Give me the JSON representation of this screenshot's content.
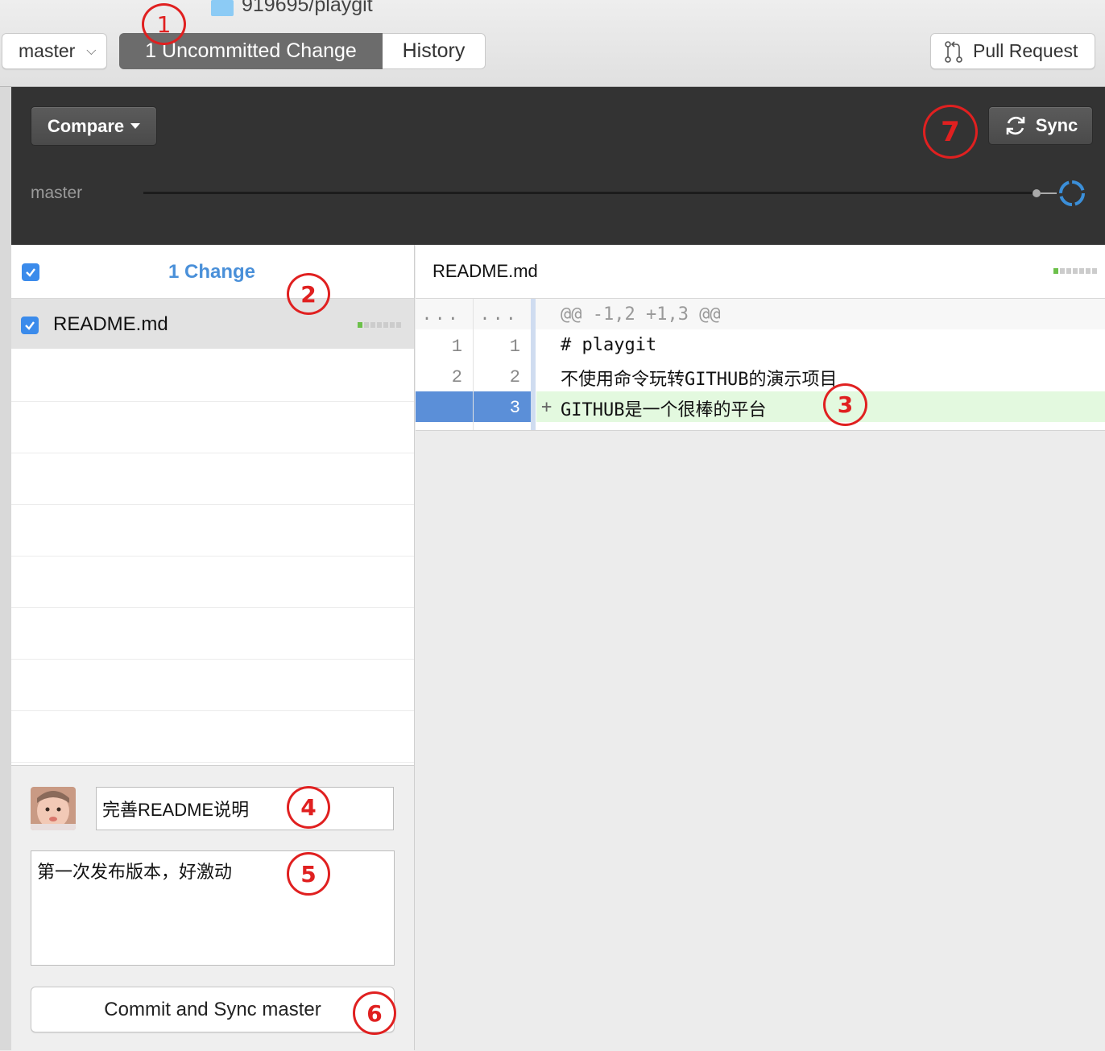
{
  "window": {
    "repo_title": "919695/playgit"
  },
  "toolbar": {
    "branch": "master",
    "tab_changes": "1 Uncommitted Change",
    "tab_history": "History",
    "pull_request": "Pull Request"
  },
  "sync_bar": {
    "compare_label": "Compare",
    "sync_label": "Sync",
    "branch_name": "master"
  },
  "changes": {
    "count_label": "1 Change",
    "files": [
      {
        "name": "README.md",
        "checked": true
      }
    ]
  },
  "diff": {
    "filename": "README.md",
    "hunk": {
      "old": "...",
      "new": "...",
      "text": "@@ -1,2 +1,3 @@"
    },
    "lines": [
      {
        "old": "1",
        "new": "1",
        "marker": "",
        "text": "# playgit",
        "type": "context"
      },
      {
        "old": "2",
        "new": "2",
        "marker": "",
        "text": "不使用命令玩转GITHUB的演示项目",
        "type": "context"
      },
      {
        "old": "",
        "new": "3",
        "marker": "+",
        "text": "GITHUB是一个很棒的平台",
        "type": "added"
      }
    ]
  },
  "commit": {
    "summary": "完善README说明",
    "description": "第一次发布版本，好激动",
    "button": "Commit and Sync master"
  },
  "annotations": [
    "1",
    "2",
    "3",
    "4",
    "5",
    "6",
    "7"
  ],
  "colors": {
    "accent": "#4a90d9",
    "added_bg": "#e3f9df",
    "annotation": "#e02020",
    "dark_band": "#333333"
  }
}
